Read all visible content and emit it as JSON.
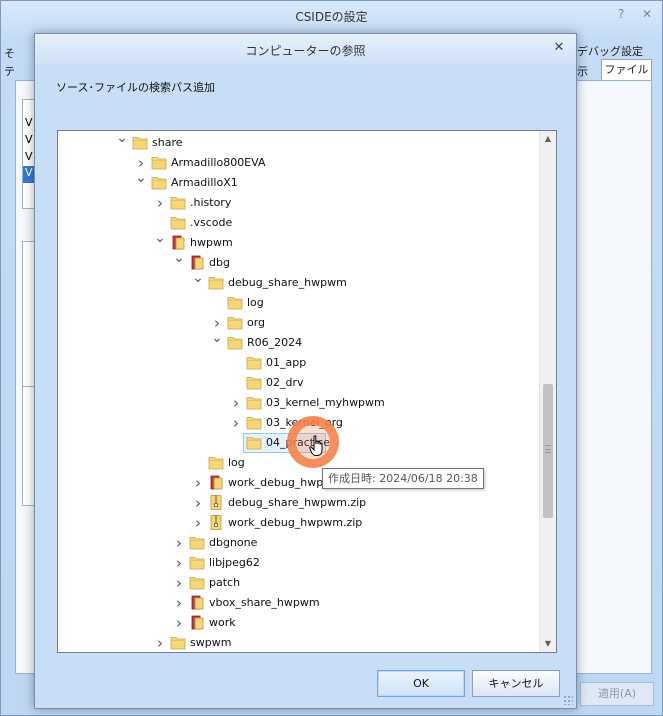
{
  "background_window": {
    "title": "CSIDEの設定",
    "help_glyph": "?",
    "close_glyph": "✕",
    "tab_debug_fragment": "デバッグ設定",
    "tab_display_fragment": "示",
    "tab_file": "ファイル",
    "left_fragments": [
      "そ",
      "テ"
    ],
    "list_fragments": [
      "V",
      "V",
      "V",
      "V"
    ],
    "apply_button": "適用(A)"
  },
  "dialog": {
    "title": "コンピューターの参照",
    "close_glyph": "✕",
    "description": "ソース･ファイルの検索パス追加",
    "ok_button": "OK",
    "cancel_button": "キャンセル",
    "tooltip": "作成日時: 2024/06/18 20:38"
  },
  "icons": {
    "folder_color": "#f5d77a",
    "folder_red_color": "#c9343e",
    "accent_orange": "#f48046"
  },
  "tree": {
    "items": [
      {
        "label": "share",
        "level": 0,
        "expander": "open",
        "icon": "folder"
      },
      {
        "label": "Armadillo800EVA",
        "level": 1,
        "expander": "closed",
        "icon": "folder"
      },
      {
        "label": "ArmadilloX1",
        "level": 1,
        "expander": "open",
        "icon": "folder"
      },
      {
        "label": ".history",
        "level": 2,
        "expander": "closed",
        "icon": "folder"
      },
      {
        "label": ".vscode",
        "level": 2,
        "expander": "none",
        "icon": "folder"
      },
      {
        "label": "hwpwm",
        "level": 2,
        "expander": "open",
        "icon": "folder-red"
      },
      {
        "label": "dbg",
        "level": 3,
        "expander": "open",
        "icon": "folder-red"
      },
      {
        "label": "debug_share_hwpwm",
        "level": 4,
        "expander": "open",
        "icon": "folder"
      },
      {
        "label": "log",
        "level": 5,
        "expander": "none",
        "icon": "folder"
      },
      {
        "label": "org",
        "level": 5,
        "expander": "closed",
        "icon": "folder"
      },
      {
        "label": "R06_2024",
        "level": 5,
        "expander": "open",
        "icon": "folder"
      },
      {
        "label": "01_app",
        "level": 6,
        "expander": "none",
        "icon": "folder"
      },
      {
        "label": "02_drv",
        "level": 6,
        "expander": "none",
        "icon": "folder"
      },
      {
        "label": "03_kernel_myhwpwm",
        "level": 6,
        "expander": "closed",
        "icon": "folder"
      },
      {
        "label": "03_kernel_org",
        "level": 6,
        "expander": "closed",
        "icon": "folder"
      },
      {
        "label": "04_practice",
        "level": 6,
        "expander": "none",
        "icon": "folder",
        "selected": true
      },
      {
        "label": "log",
        "level": 4,
        "expander": "none",
        "icon": "folder"
      },
      {
        "label": "work_debug_hwpwm",
        "level": 4,
        "expander": "closed",
        "icon": "folder-red"
      },
      {
        "label": "debug_share_hwpwm.zip",
        "level": 4,
        "expander": "closed",
        "icon": "zip"
      },
      {
        "label": "work_debug_hwpwm.zip",
        "level": 4,
        "expander": "closed",
        "icon": "zip"
      },
      {
        "label": "dbgnone",
        "level": 3,
        "expander": "closed",
        "icon": "folder"
      },
      {
        "label": "libjpeg62",
        "level": 3,
        "expander": "closed",
        "icon": "folder"
      },
      {
        "label": "patch",
        "level": 3,
        "expander": "closed",
        "icon": "folder"
      },
      {
        "label": "vbox_share_hwpwm",
        "level": 3,
        "expander": "closed",
        "icon": "folder-red"
      },
      {
        "label": "work",
        "level": 3,
        "expander": "closed",
        "icon": "folder-red"
      },
      {
        "label": "swpwm",
        "level": 2,
        "expander": "closed",
        "icon": "folder"
      }
    ]
  }
}
